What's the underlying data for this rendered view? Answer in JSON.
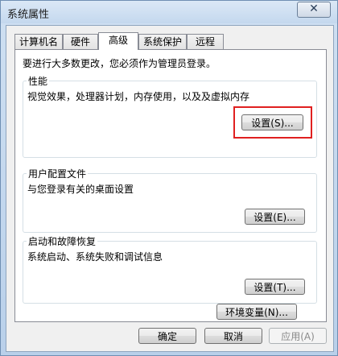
{
  "window": {
    "title": "系统属性",
    "close_glyph": "✕"
  },
  "tabs": [
    {
      "label": "计算机名"
    },
    {
      "label": "硬件"
    },
    {
      "label": "高级",
      "active": true
    },
    {
      "label": "系统保护"
    },
    {
      "label": "远程"
    }
  ],
  "panel": {
    "admin_note": "要进行大多数更改，您必须作为管理员登录。",
    "performance": {
      "title": "性能",
      "desc": "视觉效果，处理器计划，内存使用，以及及虚拟内存",
      "button": "设置(S)..."
    },
    "profile": {
      "title": "用户配置文件",
      "desc": "与您登录有关的桌面设置",
      "button": "设置(E)..."
    },
    "startup": {
      "title": "启动和故障恢复",
      "desc": "系统启动、系统失败和调试信息",
      "button": "设置(T)..."
    },
    "env_button": "环境变量(N)..."
  },
  "footer": {
    "ok": "确定",
    "cancel": "取消",
    "apply": "应用(A)"
  },
  "colors": {
    "highlight": "#e02020"
  }
}
